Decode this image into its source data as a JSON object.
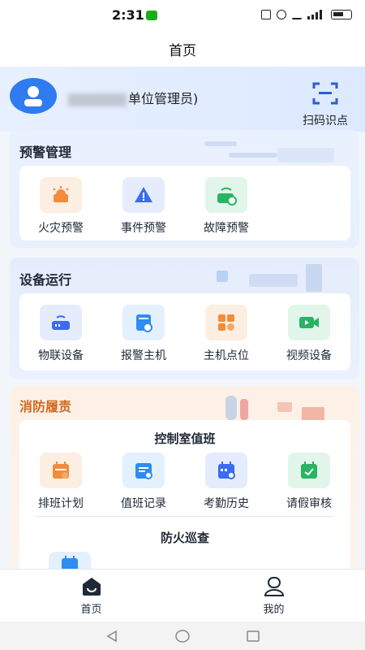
{
  "status": {
    "time": "2:31"
  },
  "nav": {
    "title": "首页"
  },
  "header": {
    "user_suffix": "单位管理员)",
    "scan_label": "扫码识点"
  },
  "warning": {
    "title": "预警管理",
    "items": [
      {
        "label": "火灾预警",
        "icon": "fire-alarm-icon",
        "color": "#f28b3a"
      },
      {
        "label": "事件预警",
        "icon": "warning-triangle-icon",
        "color": "#3b6cf0"
      },
      {
        "label": "故障预警",
        "icon": "fault-device-icon",
        "color": "#28b463"
      }
    ]
  },
  "device": {
    "title": "设备运行",
    "items": [
      {
        "label": "物联设备",
        "icon": "iot-router-icon",
        "color": "#3b6cf0"
      },
      {
        "label": "报警主机",
        "icon": "alarm-host-icon",
        "color": "#2f8cf0"
      },
      {
        "label": "主机点位",
        "icon": "host-point-icon",
        "color": "#f28b3a"
      },
      {
        "label": "视频设备",
        "icon": "video-camera-icon",
        "color": "#28b463"
      }
    ]
  },
  "fire_duty": {
    "title": "消防履责",
    "control_room": {
      "title": "控制室值班",
      "items": [
        {
          "label": "排班计划",
          "icon": "schedule-calendar-icon",
          "color": "#f28b3a"
        },
        {
          "label": "值班记录",
          "icon": "duty-record-icon",
          "color": "#2f8cf0"
        },
        {
          "label": "考勤历史",
          "icon": "attendance-history-icon",
          "color": "#3b6cf0"
        },
        {
          "label": "请假审核",
          "icon": "leave-approval-icon",
          "color": "#28b463"
        }
      ]
    },
    "patrol": {
      "title": "防火巡查"
    }
  },
  "tabbar": {
    "home_label": "首页",
    "mine_label": "我的"
  }
}
